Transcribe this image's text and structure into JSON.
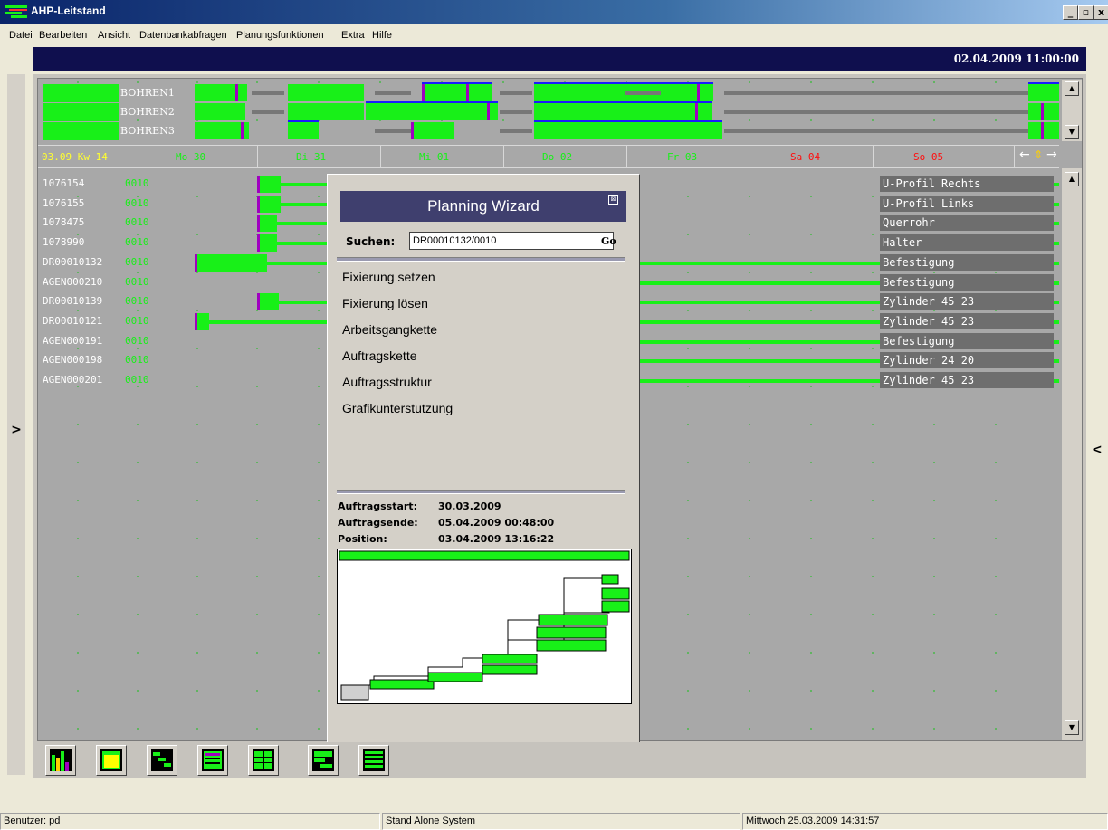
{
  "window": {
    "title": "AHP-Leitstand",
    "min": "_",
    "max": "▫",
    "close": "x"
  },
  "menu": [
    "Datei",
    "Bearbeiten",
    "Ansicht",
    "Datenbankabfragen",
    "Planungsfunktionen",
    "Extra",
    "Hilfe"
  ],
  "header": {
    "current_date": "02.04.2009 11:00:00"
  },
  "side": {
    "left_toggle": ">",
    "right_toggle": "<"
  },
  "machines": [
    "BOHREN1",
    "BOHREN2",
    "BOHREN3"
  ],
  "timeline": {
    "week": "03.09 Kw 14",
    "days": [
      {
        "label": "Mo 30",
        "color": "#18f018"
      },
      {
        "label": "Di 31",
        "color": "#18f018"
      },
      {
        "label": "Mi 01",
        "color": "#18f018"
      },
      {
        "label": "Do 02",
        "color": "#18f018"
      },
      {
        "label": "Fr 03",
        "color": "#18f018"
      },
      {
        "label": "Sa 04",
        "color": "#ff1010"
      },
      {
        "label": "So 05",
        "color": "#ff1010"
      }
    ],
    "nav": {
      "left": "←",
      "center": "⇕",
      "right": "→"
    }
  },
  "orders": [
    {
      "id": "1076154",
      "op": "0010",
      "desc": "U-Profil Rechts"
    },
    {
      "id": "1076155",
      "op": "0010",
      "desc": "U-Profil Links"
    },
    {
      "id": "1078475",
      "op": "0010",
      "desc": "Querrohr"
    },
    {
      "id": "1078990",
      "op": "0010",
      "desc": "Halter"
    },
    {
      "id": "DR00010132",
      "op": "0010",
      "desc": "Befestigung"
    },
    {
      "id": "AGEN000210",
      "op": "0010",
      "desc": "Befestigung"
    },
    {
      "id": "DR00010139",
      "op": "0010",
      "desc": "Zylinder 45 23"
    },
    {
      "id": "DR00010121",
      "op": "0010",
      "desc": "Zylinder 45 23"
    },
    {
      "id": "AGEN000191",
      "op": "0010",
      "desc": "Befestigung"
    },
    {
      "id": "AGEN000198",
      "op": "0010",
      "desc": "Zylinder 24 20"
    },
    {
      "id": "AGEN000201",
      "op": "0010",
      "desc": "Zylinder 45 23"
    }
  ],
  "wizard": {
    "title": "Planning Wizard",
    "close": "⊠",
    "search_label": "Suchen:",
    "search_value": "DR00010132/0010",
    "go_label": "Go",
    "menu": [
      "Fixierung setzen",
      "Fixierung lösen",
      "Arbeitsgangkette",
      "Auftragskette",
      "Auftragsstruktur",
      "Grafikunterstutzung"
    ],
    "info": [
      {
        "label": "Auftragsstart:",
        "value": "30.03.2009"
      },
      {
        "label": "Auftragsende:",
        "value": "05.04.2009 00:48:00"
      },
      {
        "label": "Position:",
        "value": "03.04.2009 13:16:22"
      }
    ]
  },
  "toolbar_icons": [
    "bar-chart-icon",
    "yellow-panel-icon",
    "gantt-icon",
    "schedule-icon",
    "table-icon",
    "gantt-list-icon",
    "list-icon"
  ],
  "status": {
    "user": "Benutzer: pd",
    "system": "Stand Alone System",
    "datetime": "Mittwoch 25.03.2009 14:31:57"
  },
  "colors": {
    "green": "#18f018",
    "purple": "#a000c0",
    "blue": "#1a1aff",
    "navy": "#0f0f4e"
  }
}
